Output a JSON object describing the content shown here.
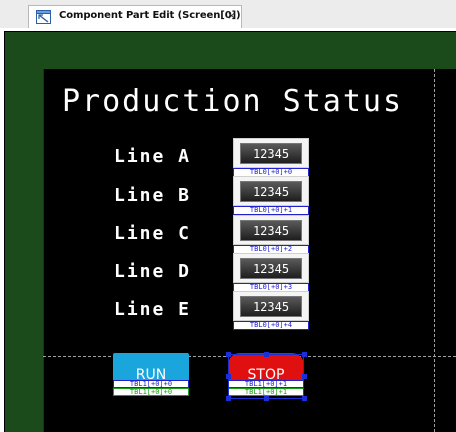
{
  "tab": {
    "title": "Component Part Edit (Screen[0])",
    "close": "×",
    "icon": "component-edit-icon"
  },
  "screen": {
    "title": "Production Status",
    "lines": [
      {
        "label": "Line A",
        "value": "12345",
        "tag": "TBL0[+0]+0"
      },
      {
        "label": "Line B",
        "value": "12345",
        "tag": "TBL0[+0]+1"
      },
      {
        "label": "Line C",
        "value": "12345",
        "tag": "TBL0[+0]+2"
      },
      {
        "label": "Line D",
        "value": "12345",
        "tag": "TBL0[+0]+3"
      },
      {
        "label": "Line E",
        "value": "12345",
        "tag": "TBL0[+0]+4"
      }
    ],
    "run_button": {
      "label": "RUN",
      "tag_blue": "TBL1[+0]+0",
      "tag_green": "TBL1[+0]+0",
      "color": "#1aa6dc"
    },
    "stop_button": {
      "label": "STOP",
      "tag_blue": "TBL1[+0]+1",
      "tag_green": "TBL1[+0]+1",
      "color": "#e01010"
    }
  },
  "colors": {
    "workspace": "#1b4a1b",
    "screen_bg": "#000000",
    "selection": "#1a2fd8",
    "tag_blue": "#2222cc",
    "tag_green": "#18a018"
  }
}
